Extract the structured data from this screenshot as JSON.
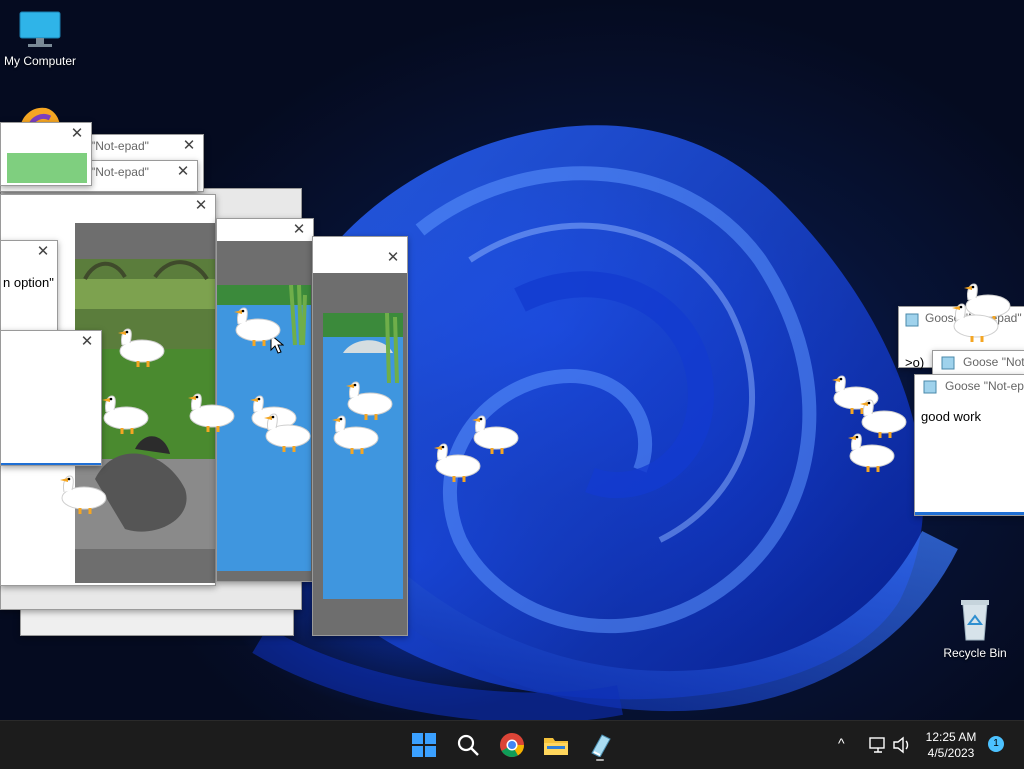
{
  "desktop": {
    "icons": [
      {
        "label": "My Computer",
        "icon": "monitor-icon"
      },
      {
        "label": "Recycle Bin",
        "icon": "recycle-bin-icon"
      }
    ]
  },
  "windows": {
    "notepad_title_1": "\"Not-epad\"",
    "notepad_title_2": "\"Not-epad\"",
    "option_text": "n option\"",
    "close_glyph": "✕",
    "goose_title_1": "Goose \"Not-epad\"",
    "goose_title_2": "Goose \"Not",
    "goose_title_3": "Goose \"Not-ep",
    "goose_ascii": ">o)",
    "goose_ascii_2": "(",
    "good_work": "good work"
  },
  "taskbar": {
    "items": [
      {
        "name": "start-button",
        "icon": "windows-logo-icon"
      },
      {
        "name": "search-button",
        "icon": "search-icon"
      },
      {
        "name": "chrome-button",
        "icon": "chrome-icon"
      },
      {
        "name": "file-explorer-button",
        "icon": "folder-icon"
      },
      {
        "name": "notepad-app-button",
        "icon": "notepad-icon"
      }
    ],
    "tray": {
      "chevron": "^",
      "time": "12:25 AM",
      "date": "4/5/2023",
      "notification_count": "1"
    }
  },
  "colors": {
    "accent": "#1f6fd4",
    "taskbar_bg": "#1c1c1c",
    "pond": "#3f96df"
  }
}
